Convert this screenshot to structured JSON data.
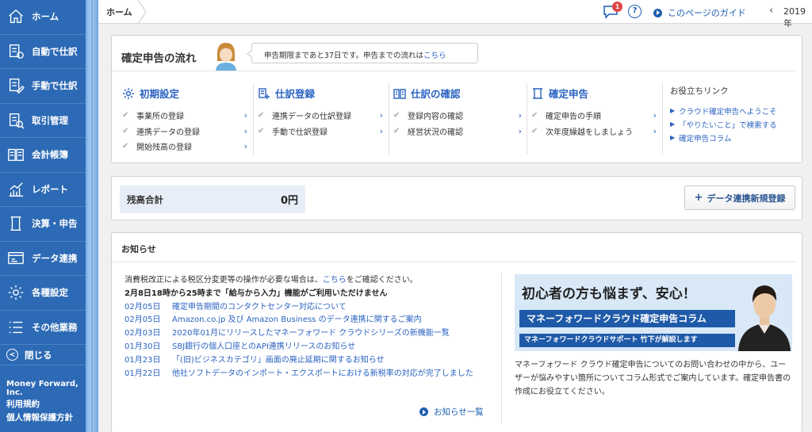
{
  "sidebar": {
    "items": [
      {
        "label": "ホーム",
        "icon": "home-icon"
      },
      {
        "label": "自動で仕訳",
        "icon": "auto-journal-icon"
      },
      {
        "label": "手動で仕訳",
        "icon": "manual-journal-icon"
      },
      {
        "label": "取引管理",
        "icon": "transaction-icon"
      },
      {
        "label": "会計帳簿",
        "icon": "ledger-icon"
      },
      {
        "label": "レポート",
        "icon": "report-icon"
      },
      {
        "label": "決算・申告",
        "icon": "settlement-icon"
      },
      {
        "label": "データ連携",
        "icon": "data-link-icon"
      },
      {
        "label": "各種設定",
        "icon": "gear-icon"
      },
      {
        "label": "その他業務",
        "icon": "list-icon"
      }
    ],
    "close_label": "閉じる",
    "company": "Money Forward, Inc.",
    "links": [
      "利用規約",
      "個人情報保護方針"
    ]
  },
  "topbar": {
    "breadcrumb": "ホーム",
    "badge_count": "1",
    "help": "?",
    "guide_label": "このページのガイド",
    "prev": "‹",
    "year": "2019年"
  },
  "flow": {
    "title": "確定申告の流れ",
    "notice": "申告期限まであと37日です。申告までの流れは",
    "notice_link": "こちら",
    "columns": [
      {
        "title": "初期設定",
        "items": [
          "事業所の登録",
          "連携データの登録",
          "開始残高の登録"
        ]
      },
      {
        "title": "仕訳登録",
        "items": [
          "連携データの仕訳登録",
          "手動で仕訳登録"
        ]
      },
      {
        "title": "仕訳の確認",
        "items": [
          "登録内容の確認",
          "経営状況の確認"
        ]
      },
      {
        "title": "確定申告",
        "items": [
          "確定申告の手順",
          "次年度繰越をしましょう"
        ]
      }
    ],
    "links_title": "お役立ちリンク",
    "links": [
      "クラウド確定申告へようこそ",
      "「やりたいこと」で検索する",
      "確定申告コラム"
    ]
  },
  "balance": {
    "label": "残高合計",
    "value": "0円",
    "add_button": "データ連携新規登録"
  },
  "news": {
    "title": "お知らせ",
    "intro": "消費税改正による税区分変更等の操作が必要な場合は、",
    "intro_link": "こちら",
    "intro_end": "をご確認ください。",
    "bold": "2月8日18時から25時まで「給与から入力」機能がご利用いただけません",
    "items": [
      {
        "date": "02月05日",
        "text": "確定申告期間のコンタクトセンター対応について"
      },
      {
        "date": "02月05日",
        "text": "Amazon.co.jp 及び Amazon Business のデータ連携に関するご案内"
      },
      {
        "date": "02月03日",
        "text": "2020年01月にリリースしたマネーフォワード クラウドシリーズの新機能一覧"
      },
      {
        "date": "01月30日",
        "text": "SBJ銀行の個人口座とのAPI連携リリースのお知らせ"
      },
      {
        "date": "01月23日",
        "text": "「(旧)ビジネスカテゴリ」画面の廃止延期に関するお知らせ"
      },
      {
        "date": "01月22日",
        "text": "他社ソフトデータのインポート・エクスポートにおける新税率の対応が完了しました"
      }
    ],
    "more": "お知らせ一覧"
  },
  "banner": {
    "headline": "初心者の方も悩まず、安心！",
    "sub": "マネーフォワードクラウド確定申告コラム",
    "credit": "マネーフォワードクラウドサポート 竹下が解説します",
    "desc": "マネーフォワード クラウド確定申告についてのお問い合わせの中から、ユーザーが悩みやすい箇所についてコラム形式でご案内しています。確定申告書の作成にお役立てください。"
  }
}
